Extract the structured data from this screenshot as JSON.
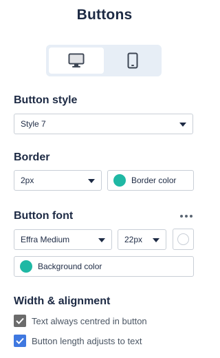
{
  "panel": {
    "title": "Buttons"
  },
  "device_toggle": {
    "desktop_icon": "desktop-icon",
    "mobile_icon": "mobile-icon",
    "selected": "desktop"
  },
  "button_style": {
    "label": "Button style",
    "value": "Style 7"
  },
  "border": {
    "label": "Border",
    "width_value": "2px",
    "color_label": "Border color",
    "color": "#1fb8a4"
  },
  "button_font": {
    "label": "Button font",
    "font_value": "Effra Medium",
    "size_value": "22px",
    "font_color": "#ffffff",
    "more_icon": "more-horizontal-icon"
  },
  "background": {
    "label": "Background color",
    "color": "#1fb8a4"
  },
  "width_alignment": {
    "label": "Width & alignment",
    "options": [
      {
        "label": "Text always centred in button",
        "checked": true,
        "style_color": "#6b6b6b"
      },
      {
        "label": "Button length adjusts to text",
        "checked": true,
        "style_color": "#3f78e0"
      }
    ]
  }
}
